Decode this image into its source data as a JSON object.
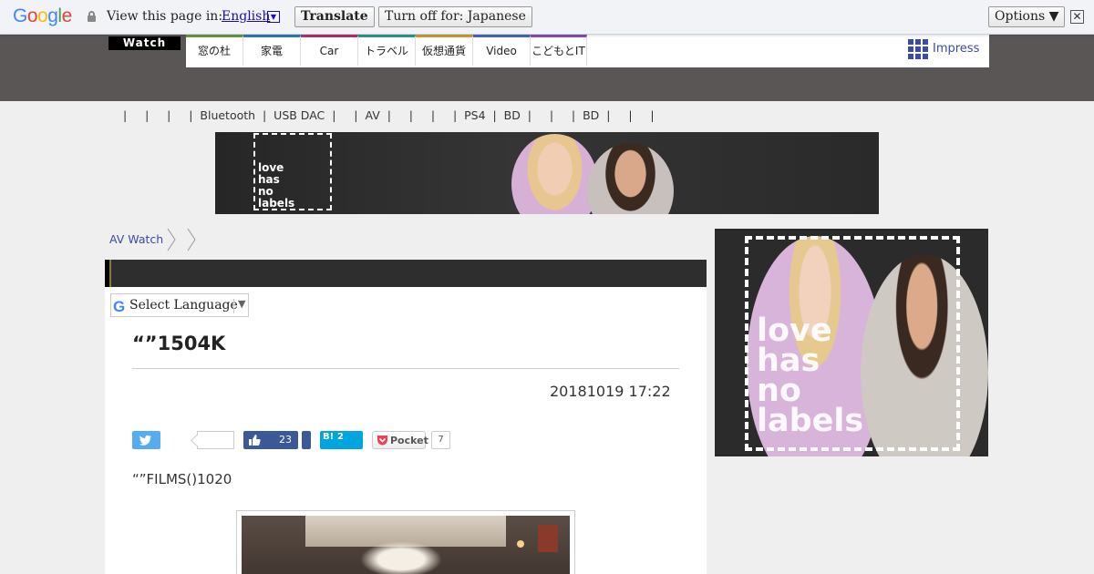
{
  "translate_bar": {
    "logo": "Google",
    "prompt": "View this page in:",
    "language": "English",
    "translate_label": "Translate",
    "turn_off_label": "Turn off for: Japanese",
    "options_label": "Options ▼",
    "close_label": "✕"
  },
  "header": {
    "logo": "Watch",
    "nav": [
      {
        "label": "窓の杜",
        "color": "#6a9a3a"
      },
      {
        "label": "家電",
        "color": "#2f7bbd"
      },
      {
        "label": "Car",
        "color": "#b0346a"
      },
      {
        "label": "トラベル",
        "color": "#2a9a8a"
      },
      {
        "label": "仮想通貨",
        "color": "#d89a2a"
      },
      {
        "label": "Video",
        "color": "#4a6ab8"
      },
      {
        "label": "こどもとIT",
        "color": "#8a4ab8"
      }
    ],
    "impress_label": "Impress"
  },
  "subnav": "|     |     |     |  Bluetooth  |  USB DAC  |     |  AV  |     |     |     |  PS4  |  BD  |     |     |  BD  |     |     |",
  "banner_ad": {
    "text": [
      "love",
      "has",
      "no",
      "labels"
    ]
  },
  "breadcrumb": {
    "root": "AV Watch"
  },
  "article": {
    "select_language": "Select Language",
    "select_arrow": "▼",
    "headline": "“”1504K",
    "date": "20181019 17:22",
    "facebook_count": "23",
    "hatena_count": "2",
    "hatena_label": "B!",
    "pocket_label": "Pocket",
    "pocket_count": "7",
    "lede": "“”FILMS()1020"
  },
  "side_ad": {
    "text": [
      "love",
      "has",
      "no",
      "labels"
    ]
  }
}
